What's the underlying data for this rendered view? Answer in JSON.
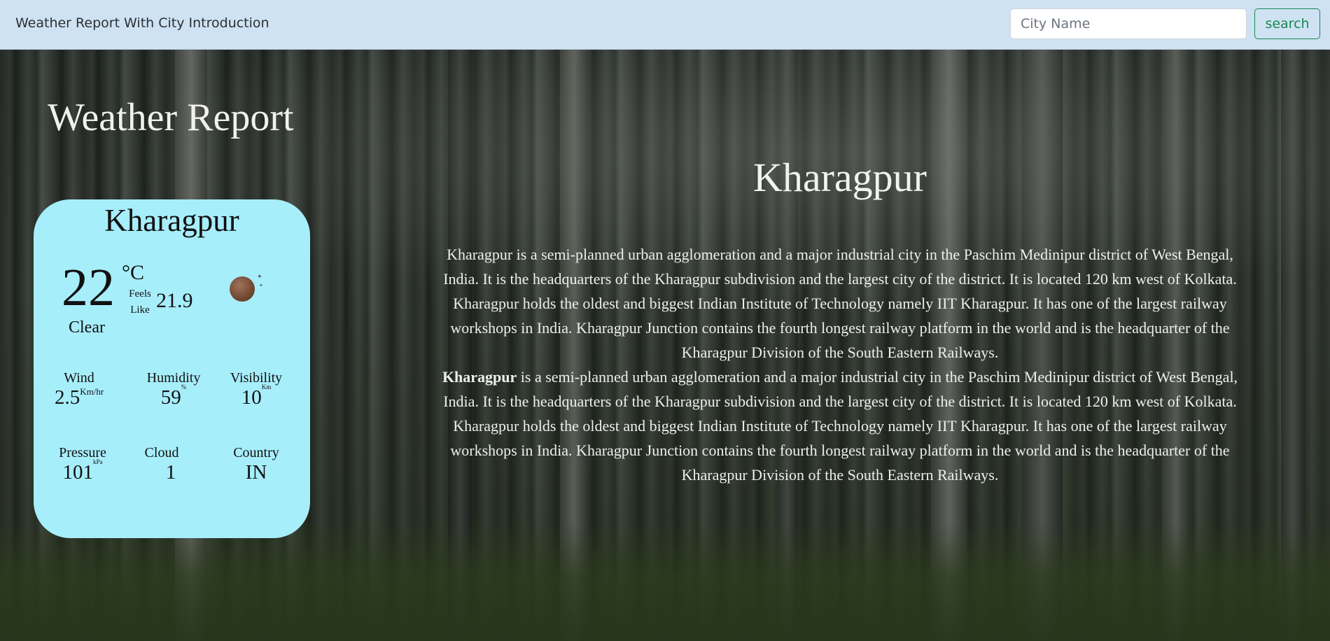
{
  "navbar": {
    "brand": "Weather Report With City Introduction",
    "search_placeholder": "City Name",
    "search_button": "search"
  },
  "report": {
    "heading": "Weather Report",
    "city": "Kharagpur",
    "temperature": "22",
    "unit": "°C",
    "feels_label_1": "Feels",
    "feels_label_2": "Like",
    "feels_value": "21.9",
    "condition": "Clear",
    "condition_icon": "moon-icon",
    "stats": {
      "wind": {
        "label": "Wind",
        "value": "2.5",
        "unit": "Km/hr"
      },
      "humidity": {
        "label": "Humidity",
        "value": "59",
        "unit": "%"
      },
      "visibility": {
        "label": "Visibility",
        "value": "10",
        "unit": "Km"
      },
      "pressure": {
        "label": "Pressure",
        "value": "101",
        "unit": "kPa"
      },
      "cloud": {
        "label": "Cloud",
        "value": "1"
      },
      "country": {
        "label": "Country",
        "value": "IN"
      }
    }
  },
  "intro": {
    "title": "Kharagpur",
    "paragraph_1": "Kharagpur is a semi-planned urban agglomeration and a major industrial city in the Paschim Medinipur district of West Bengal, India. It is the headquarters of the Kharagpur subdivision and the largest city of the district. It is located 120 km west of Kolkata. Kharagpur holds the oldest and biggest Indian Institute of Technology namely IIT Kharagpur. It has one of the largest railway workshops in India. Kharagpur Junction contains the fourth longest railway platform in the world and is the headquarter of the Kharagpur Division of the South Eastern Railways.",
    "paragraph_2_bold": "Kharagpur",
    "paragraph_2_rest": " is a semi-planned urban agglomeration and a major industrial city in the Paschim Medinipur district of West Bengal, India. It is the headquarters of the Kharagpur subdivision and the largest city of the district. It is located 120 km west of Kolkata. Kharagpur holds the oldest and biggest Indian Institute of Technology namely IIT Kharagpur. It has one of the largest railway workshops in India. Kharagpur Junction contains the fourth longest railway platform in the world and is the headquarter of the Kharagpur Division of the South Eastern Railways."
  },
  "colors": {
    "navbar_bg": "#cfe2f3",
    "card_bg": "#a7eefb",
    "search_button": "#198754"
  }
}
